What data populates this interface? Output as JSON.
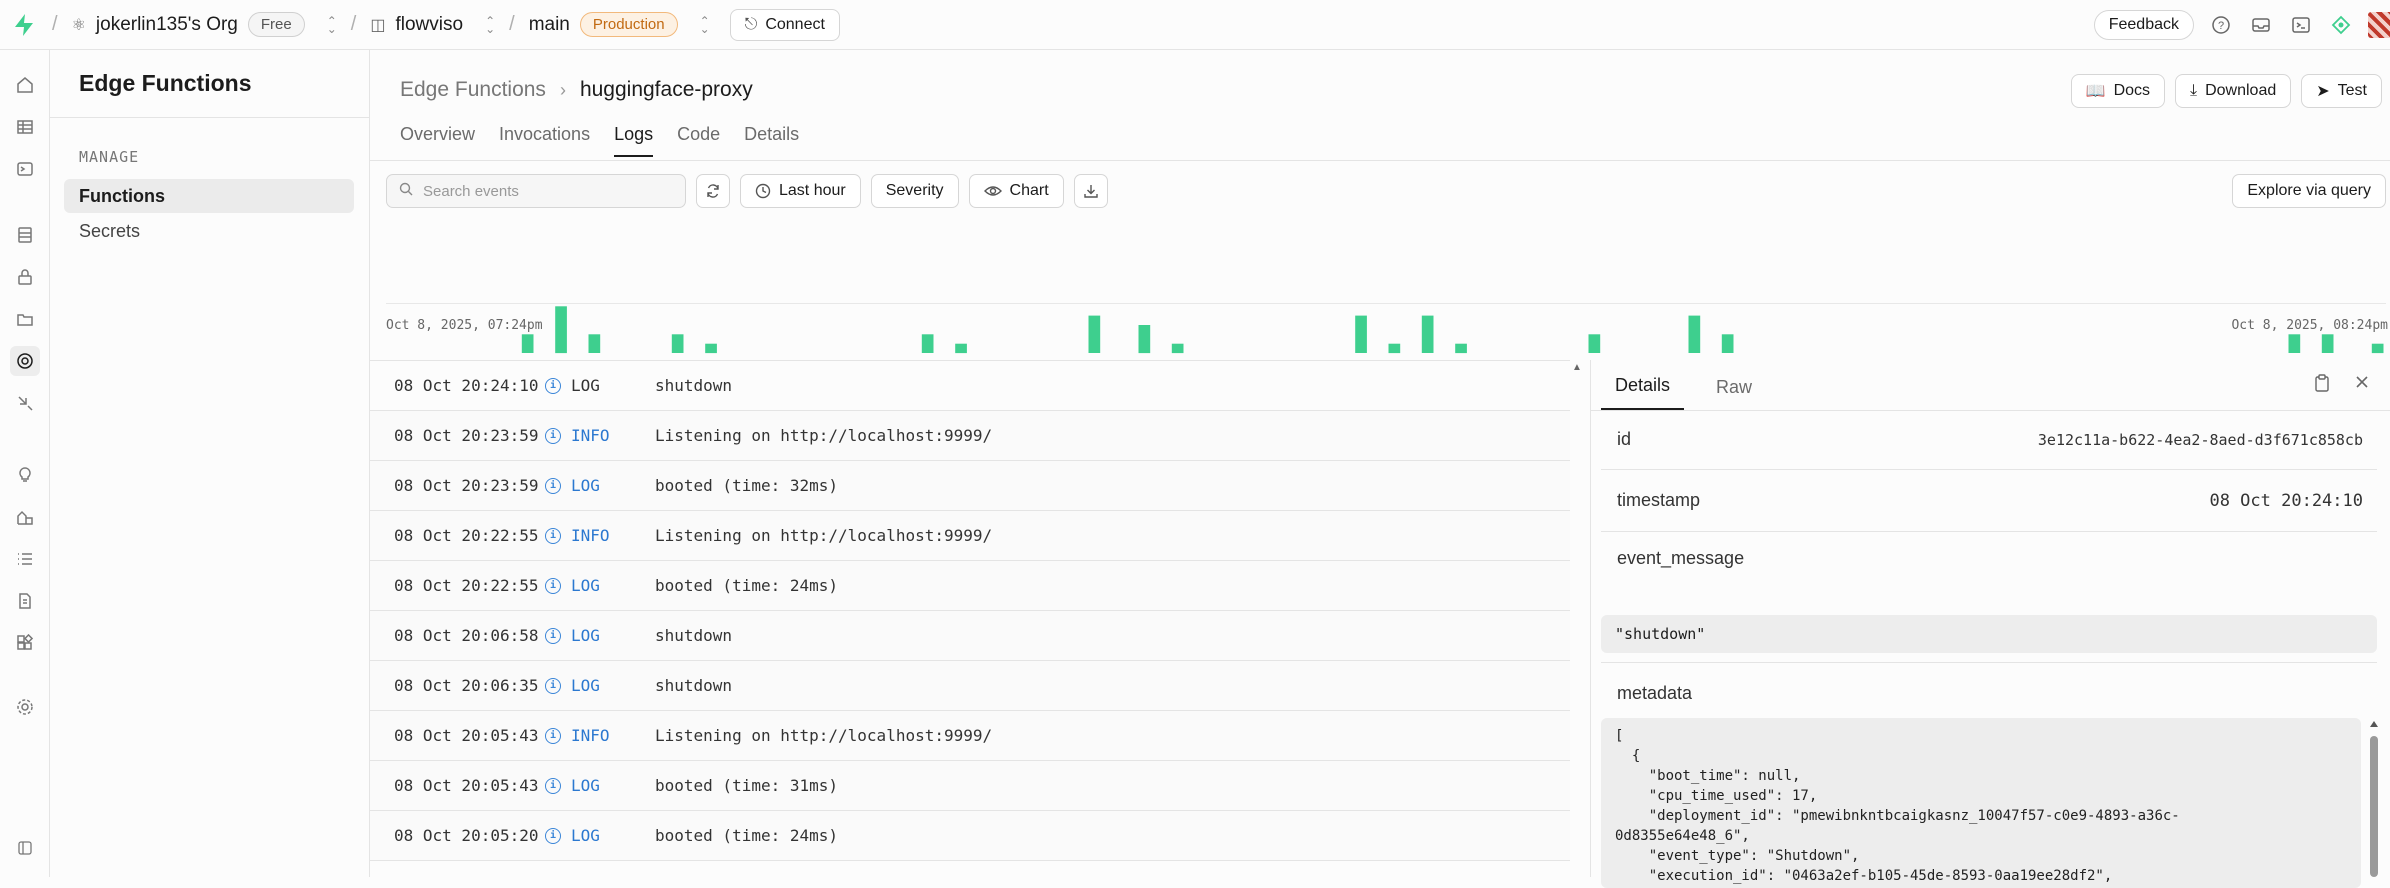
{
  "topbar": {
    "org_name": "jokerlin135's Org",
    "org_plan": "Free",
    "project": "flowviso",
    "branch": "main",
    "branch_env": "Production",
    "connect_label": "Connect",
    "feedback_label": "Feedback"
  },
  "sidebar": {
    "title": "Edge Functions",
    "section": "MANAGE",
    "items": [
      {
        "label": "Functions"
      },
      {
        "label": "Secrets"
      }
    ]
  },
  "main": {
    "breadcrumb_parent": "Edge Functions",
    "breadcrumb_current": "huggingface-proxy",
    "actions": {
      "docs": "Docs",
      "download": "Download",
      "test": "Test"
    },
    "tabs": [
      {
        "label": "Overview"
      },
      {
        "label": "Invocations"
      },
      {
        "label": "Logs"
      },
      {
        "label": "Code"
      },
      {
        "label": "Details"
      }
    ],
    "filters": {
      "search_placeholder": "Search events",
      "time_range": "Last hour",
      "severity": "Severity",
      "chart": "Chart",
      "explore": "Explore via query"
    }
  },
  "chart_data": {
    "type": "bar",
    "x_start_label": "Oct 8, 2025, 07:24pm",
    "x_end_label": "Oct 8, 2025, 08:24pm",
    "bar_color": "#3ecf8e",
    "values": [
      0,
      0,
      0,
      0,
      0,
      0,
      0,
      0,
      1,
      0,
      2.5,
      0,
      1,
      0,
      0,
      0,
      0,
      1,
      0,
      0.5,
      0,
      0,
      0,
      0,
      0,
      0,
      0,
      0,
      0,
      0,
      0,
      0,
      1,
      0,
      0.5,
      0,
      0,
      0,
      0,
      0,
      0,
      0,
      2,
      0,
      0,
      1.5,
      0,
      0.5,
      0,
      0,
      0,
      0,
      0,
      0,
      0,
      0,
      0,
      0,
      2,
      0,
      0.5,
      0,
      2,
      0,
      0.5,
      0,
      0,
      0,
      0,
      0,
      0,
      0,
      1,
      0,
      0,
      0,
      0,
      0,
      2,
      0,
      1,
      0,
      0,
      0,
      0,
      0,
      0,
      0,
      0,
      0,
      0,
      0,
      0,
      0,
      0,
      0,
      0,
      0,
      0,
      0,
      0,
      0,
      0,
      0,
      0,
      0,
      0,
      0,
      0,
      0,
      0,
      0,
      0,
      0,
      1,
      0,
      1,
      0,
      0,
      0.5
    ]
  },
  "logs": [
    {
      "ts": "08 Oct 20:24:10",
      "level": "LOG",
      "msg": "shutdown"
    },
    {
      "ts": "08 Oct 20:23:59",
      "level": "INFO",
      "msg": "Listening on http://localhost:9999/"
    },
    {
      "ts": "08 Oct 20:23:59",
      "level": "LOG",
      "msg": "booted (time: 32ms)"
    },
    {
      "ts": "08 Oct 20:22:55",
      "level": "INFO",
      "msg": "Listening on http://localhost:9999/"
    },
    {
      "ts": "08 Oct 20:22:55",
      "level": "LOG",
      "msg": "booted (time: 24ms)"
    },
    {
      "ts": "08 Oct 20:06:58",
      "level": "LOG",
      "msg": "shutdown"
    },
    {
      "ts": "08 Oct 20:06:35",
      "level": "LOG",
      "msg": "shutdown"
    },
    {
      "ts": "08 Oct 20:05:43",
      "level": "INFO",
      "msg": "Listening on http://localhost:9999/"
    },
    {
      "ts": "08 Oct 20:05:43",
      "level": "LOG",
      "msg": "booted (time: 31ms)"
    },
    {
      "ts": "08 Oct 20:05:20",
      "level": "LOG",
      "msg": "booted (time: 24ms)"
    }
  ],
  "details": {
    "tabs": [
      {
        "label": "Details"
      },
      {
        "label": "Raw"
      }
    ],
    "id_key": "id",
    "id_value": "3e12c11a-b622-4ea2-8aed-d3f671c858cb",
    "timestamp_key": "timestamp",
    "timestamp_value": "08 Oct 20:24:10",
    "event_message_key": "event_message",
    "event_message_value": "\"shutdown\"",
    "metadata_key": "metadata",
    "metadata_value": "[\n  {\n    \"boot_time\": null,\n    \"cpu_time_used\": 17,\n    \"deployment_id\": \"pmewibnkntbcaigkasnz_10047f57-c0e9-4893-a36c-\n0d8355e64e48_6\",\n    \"event_type\": \"Shutdown\",\n    \"execution_id\": \"0463a2ef-b105-45de-8593-0aa19ee28df2\","
  }
}
